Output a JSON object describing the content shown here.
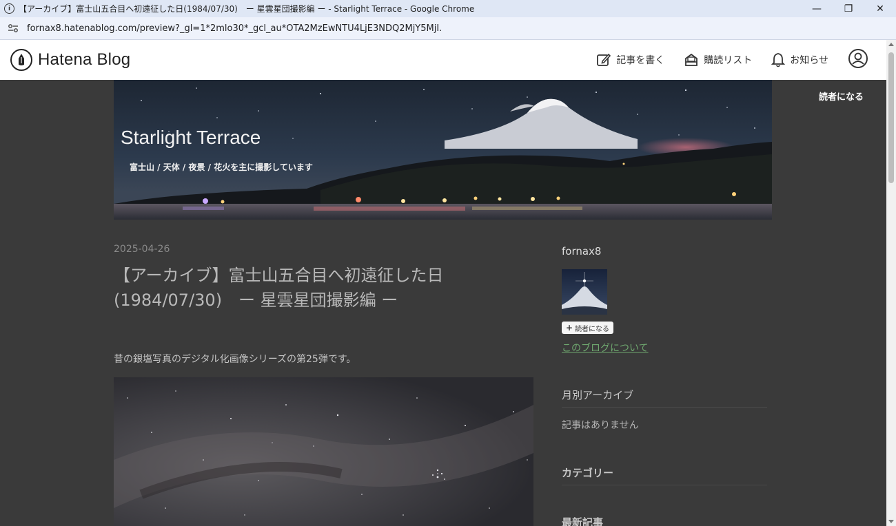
{
  "browser": {
    "window_title": "【アーカイブ】富士山五合目へ初遠征した日(1984/07/30)　ー 星雲星団撮影編 ー - Starlight Terrace - Google Chrome",
    "url": "fornax8.hatenablog.com/preview?_gl=1*2mlo30*_gcl_au*OTA2MzEwNTU4LjE3NDQ2MjY5MjI.",
    "minimize_glyph": "—",
    "restore_glyph": "❐",
    "close_glyph": "✕"
  },
  "hatena": {
    "logo_text": "Hatena Blog",
    "nav": {
      "write": "記事を書く",
      "reading_list": "購読リスト",
      "notifications": "お知らせ"
    }
  },
  "blog": {
    "title": "Starlight Terrace",
    "description": "富士山 / 天体 / 夜景 / 花火を主に撮影しています",
    "subscribe_label": "読者になる"
  },
  "entry": {
    "date": "2025-04-26",
    "title": "【アーカイブ】富士山五合目へ初遠征した日(1984/07/30)　ー 星雲星団撮影編 ー",
    "intro": "昔の銀塩写真のデジタル化画像シリーズの第25弾です。"
  },
  "sidebar": {
    "profile_name": "fornax8",
    "follow_label": "読者になる",
    "follow_plus": "+",
    "about_link": "このブログについて",
    "archive_heading": "月別アーカイブ",
    "archive_empty": "記事はありません",
    "category_heading": "カテゴリー",
    "recent_heading": "最新記事"
  },
  "colors": {
    "page_bg": "#3a3a3a",
    "header_bg": "#ffffff",
    "link_green": "#6fa86f",
    "chrome_titlebar": "#dfe7f5"
  }
}
